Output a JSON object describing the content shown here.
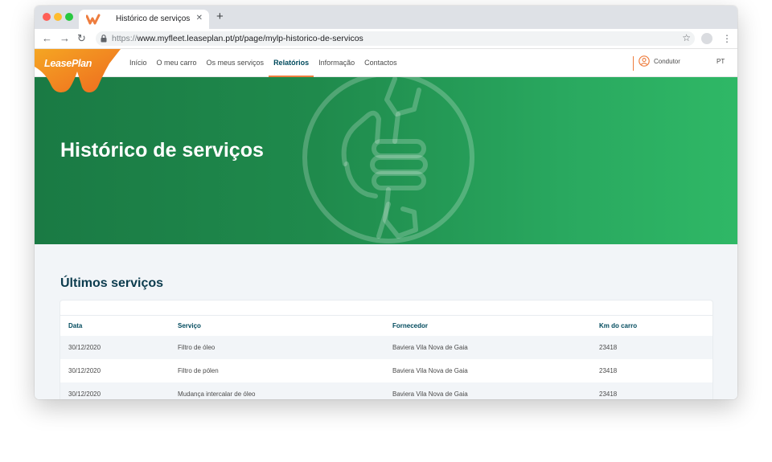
{
  "browser": {
    "tab_title": "Histórico de serviços",
    "new_tab": "+",
    "close": "✕",
    "url_protocol": "https://",
    "url_rest": "www.myfleet.leaseplan.pt/pt/page/mylp-historico-de-servicos",
    "nav": {
      "back": "←",
      "forward": "→",
      "reload": "↻",
      "star": "☆",
      "menu": "⋮"
    }
  },
  "site": {
    "logo_text": "LeasePlan",
    "brand_color": "#ee7d3e",
    "nav_items": [
      {
        "label": "Início"
      },
      {
        "label": "O meu carro"
      },
      {
        "label": "Os meus serviços"
      },
      {
        "label": "Relatórios",
        "active": true
      },
      {
        "label": "Informação"
      },
      {
        "label": "Contactos"
      }
    ],
    "user_label": "Condutor",
    "language": "PT"
  },
  "hero": {
    "title": "Histórico de serviços",
    "icon": "thumbs-up-wrench-icon"
  },
  "services": {
    "title": "Últimos serviços",
    "columns": [
      "Data",
      "Serviço",
      "Fornecedor",
      "Km do carro"
    ],
    "rows": [
      {
        "date": "30/12/2020",
        "service": "Filtro de óleo",
        "supplier": "Baviera Vila Nova de Gaia",
        "km": "23418"
      },
      {
        "date": "30/12/2020",
        "service": "Filtro de pólen",
        "supplier": "Baviera Vila Nova de Gaia",
        "km": "23418"
      },
      {
        "date": "30/12/2020",
        "service": "Mudança intercalar de óleo",
        "supplier": "Baviera Vila Nova de Gaia",
        "km": "23418"
      }
    ]
  }
}
